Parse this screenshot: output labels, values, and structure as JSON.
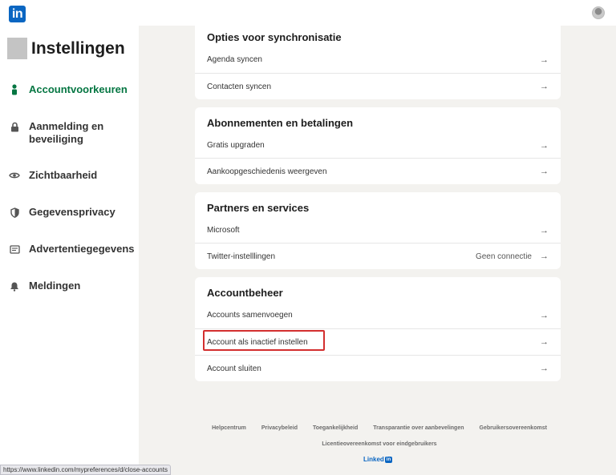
{
  "app": {
    "logo_text": "in",
    "page_title": "Instellingen"
  },
  "sidebar": {
    "items": [
      {
        "label": "Accountvoorkeuren",
        "icon": "person-icon",
        "active": true
      },
      {
        "label": "Aanmelding en beveiliging",
        "icon": "lock-icon",
        "active": false
      },
      {
        "label": "Zichtbaarheid",
        "icon": "eye-icon",
        "active": false
      },
      {
        "label": "Gegevensprivacy",
        "icon": "shield-icon",
        "active": false
      },
      {
        "label": "Advertentiegegevens",
        "icon": "ad-icon",
        "active": false
      },
      {
        "label": "Meldingen",
        "icon": "bell-icon",
        "active": false
      }
    ]
  },
  "sections": {
    "sync": {
      "title": "Opties voor synchronisatie",
      "rows": [
        {
          "label": "Agenda syncen"
        },
        {
          "label": "Contacten syncen"
        }
      ]
    },
    "subscriptions": {
      "title": "Abonnementen en betalingen",
      "rows": [
        {
          "label": "Gratis upgraden"
        },
        {
          "label": "Aankoopgeschiedenis weergeven"
        }
      ]
    },
    "partners": {
      "title": "Partners en services",
      "rows": [
        {
          "label": "Microsoft"
        },
        {
          "label": "Twitter-instelllingen",
          "extra": "Geen connectie"
        }
      ]
    },
    "account": {
      "title": "Accountbeheer",
      "rows": [
        {
          "label": "Accounts samenvoegen"
        },
        {
          "label": "Account als inactief instellen"
        },
        {
          "label": "Account sluiten"
        }
      ]
    }
  },
  "footer": {
    "links": [
      "Helpcentrum",
      "Privacybeleid",
      "Toegankelijkheid",
      "Transparantie over aanbevelingen",
      "Gebruikersovereenkomst"
    ],
    "line2": "Licentieovereenkomst voor eindgebruikers",
    "brand": "Linked",
    "brand_in": "in"
  },
  "statusbar": {
    "url": "https://www.linkedin.com/mypreferences/d/close-accounts"
  },
  "colors": {
    "brand": "#0a66c2",
    "active": "#057642",
    "highlight": "#d32f2f"
  }
}
